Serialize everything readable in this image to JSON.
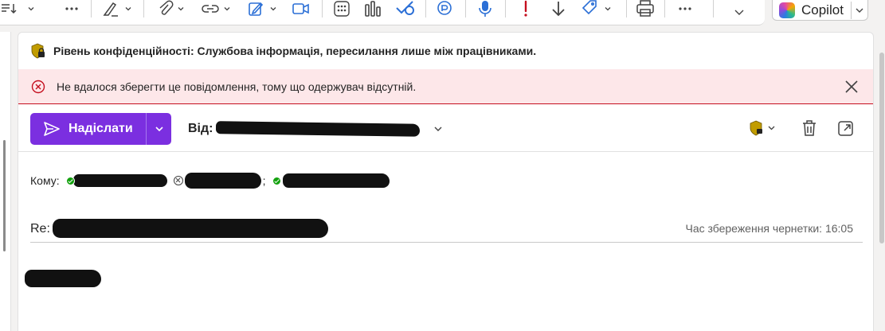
{
  "toolbar": {
    "icons": [
      "sort-icon",
      "more-icon",
      "pen-icon",
      "attach-icon",
      "link-icon",
      "signature-icon",
      "meet-icon",
      "apps-icon",
      "poll-icon",
      "loop-icon",
      "viva-icon",
      "dictate-icon",
      "importance-high-icon",
      "importance-low-icon",
      "sensitivity-icon",
      "print-icon",
      "more-icon",
      "collapse-icon"
    ]
  },
  "copilot": {
    "label": "Copilot"
  },
  "sensitivity": {
    "text": "Рівень конфіденційності: Службова інформація, пересилання лише між працівниками.",
    "colors": {
      "shield": "#c19c00",
      "lock": "#242424"
    }
  },
  "error": {
    "text": "Не вдалося зберегти це повідомлення, тому що одержувач відсутній.",
    "background": "#fde7e9",
    "border": "#c50f1f"
  },
  "send": {
    "label": "Надіслати",
    "color": "#7b2fe0"
  },
  "from": {
    "label": "Від:"
  },
  "to": {
    "label": "Кому:",
    "recipients": [
      {
        "status": "available",
        "display": "redacted"
      },
      {
        "status": "unavailable",
        "display": "redacted"
      },
      {
        "status": "available",
        "display": "redacted"
      }
    ]
  },
  "subject": {
    "prefix": "Re:"
  },
  "draft": {
    "saved_text": "Час збереження чернетки: 16:05"
  }
}
